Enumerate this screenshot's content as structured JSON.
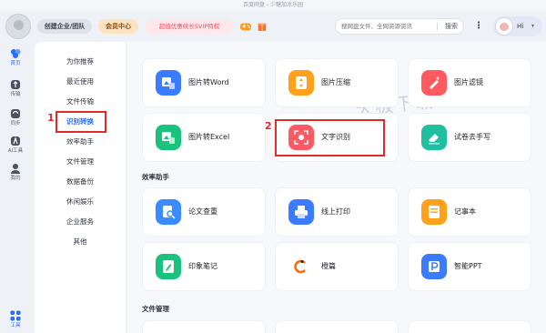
{
  "window": {
    "title": "百度网盘 - 少糖加冰乐园"
  },
  "header": {
    "enterprise_label": "创建企业/团队",
    "member_label": "会员中心",
    "svip_label": "超值优惠续长SVIP特权",
    "search_placeholder": "搜网盘文件、全网资源资讯",
    "search_button": "搜索",
    "more_glyph": "⋮",
    "user_greeting": "Hi",
    "user_chevron": "▾"
  },
  "rail": {
    "items": [
      {
        "label": "首页",
        "icon": "home-icon"
      },
      {
        "label": "传输",
        "icon": "transfer-icon"
      },
      {
        "label": "同步",
        "icon": "sync-icon"
      },
      {
        "label": "AI工具",
        "icon": "ai-tools-icon"
      },
      {
        "label": "我的",
        "icon": "profile-icon"
      }
    ],
    "bottom": {
      "label": "工具",
      "icon": "tools-grid-icon"
    }
  },
  "menu": {
    "items": [
      "为你推荐",
      "最近使用",
      "文件传输",
      "识别转换",
      "效率助手",
      "文件管理",
      "数据备份",
      "休闲娱乐",
      "企业服务",
      "其他"
    ],
    "active_index": 3
  },
  "main": {
    "watermark": "天极下载站",
    "sections": [
      {
        "title": "效率助手"
      },
      {
        "title": "文件管理"
      }
    ],
    "cards": {
      "img2word": {
        "label": "图片转Word",
        "color": "#3a7bff"
      },
      "img_compress": {
        "label": "图片压缩",
        "color": "#ffa11a"
      },
      "img_filter": {
        "label": "图片滤镜",
        "color": "#ff5a5f"
      },
      "img2excel": {
        "label": "图片转Excel",
        "color": "#19c37d"
      },
      "ocr": {
        "label": "文字识别",
        "color": "#ff5a64"
      },
      "erase_handwriting": {
        "label": "试卷去手写",
        "color": "#1fbfa0"
      },
      "paper_check": {
        "label": "论文查重",
        "color": "#3a8bff"
      },
      "online_print": {
        "label": "线上打印",
        "color": "#3a7bff"
      },
      "notepad": {
        "label": "记事本",
        "color": "#ffa11a"
      },
      "inkstroke": {
        "label": "印象笔记",
        "color": "#19c37d"
      },
      "wenku": {
        "label": "橙篇",
        "color": "#ff6a00"
      },
      "smart_ppt": {
        "label": "智能PPT",
        "color": "#3a7bff"
      }
    }
  },
  "annotations": {
    "one": "1",
    "two": "2"
  }
}
